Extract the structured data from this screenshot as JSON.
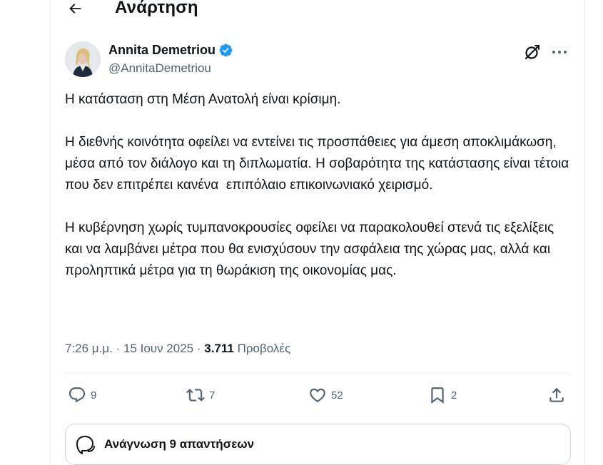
{
  "header": {
    "title": "Ανάρτηση"
  },
  "author": {
    "display_name": "Annita Demetriou",
    "handle": "@AnnitaDemetriou",
    "verified": true
  },
  "tweet": {
    "paragraphs": [
      "Η κατάσταση στη Μέση Ανατολή είναι κρίσιμη.",
      "Η διεθνής κοινότητα οφείλει να εντείνει τις προσπάθειες για άμεση αποκλιμάκωση, μέσα από τον διάλογο και τη διπλωματία. Η σοβαρότητα της κατάστασης είναι τέτοια που δεν επιτρέπει κανένα  επιπόλαιο επικοινωνιακό χειρισμό.",
      "Η κυβέρνηση χωρίς τυμπανοκρουσίες οφείλει να παρακολουθεί στενά τις εξελίξεις και να λαμβάνει μέτρα που θα ενισχύσουν την ασφάλεια της χώρας μας, αλλά και προληπτικά μέτρα για τη θωράκιση της οικονομίας μας."
    ]
  },
  "meta": {
    "time": "7:26 μ.μ.",
    "separator": " · ",
    "date": "15 Ιουν 2025",
    "views_count": "3.711",
    "views_label": "Προβολές"
  },
  "actions": {
    "replies": "9",
    "reposts": "7",
    "likes": "52",
    "bookmarks": "2"
  },
  "replies_box": {
    "label": "Ανάγνωση 9 απαντήσεων"
  },
  "colors": {
    "text_primary": "#0f1419",
    "text_secondary": "#536471",
    "verified_blue": "#1d9bf0",
    "border": "#cfd9de"
  },
  "icons": [
    "back-arrow-icon",
    "verified-badge-icon",
    "grok-icon",
    "more-icon",
    "reply-icon",
    "repost-icon",
    "like-icon",
    "bookmark-icon",
    "share-icon",
    "conversation-icon"
  ]
}
